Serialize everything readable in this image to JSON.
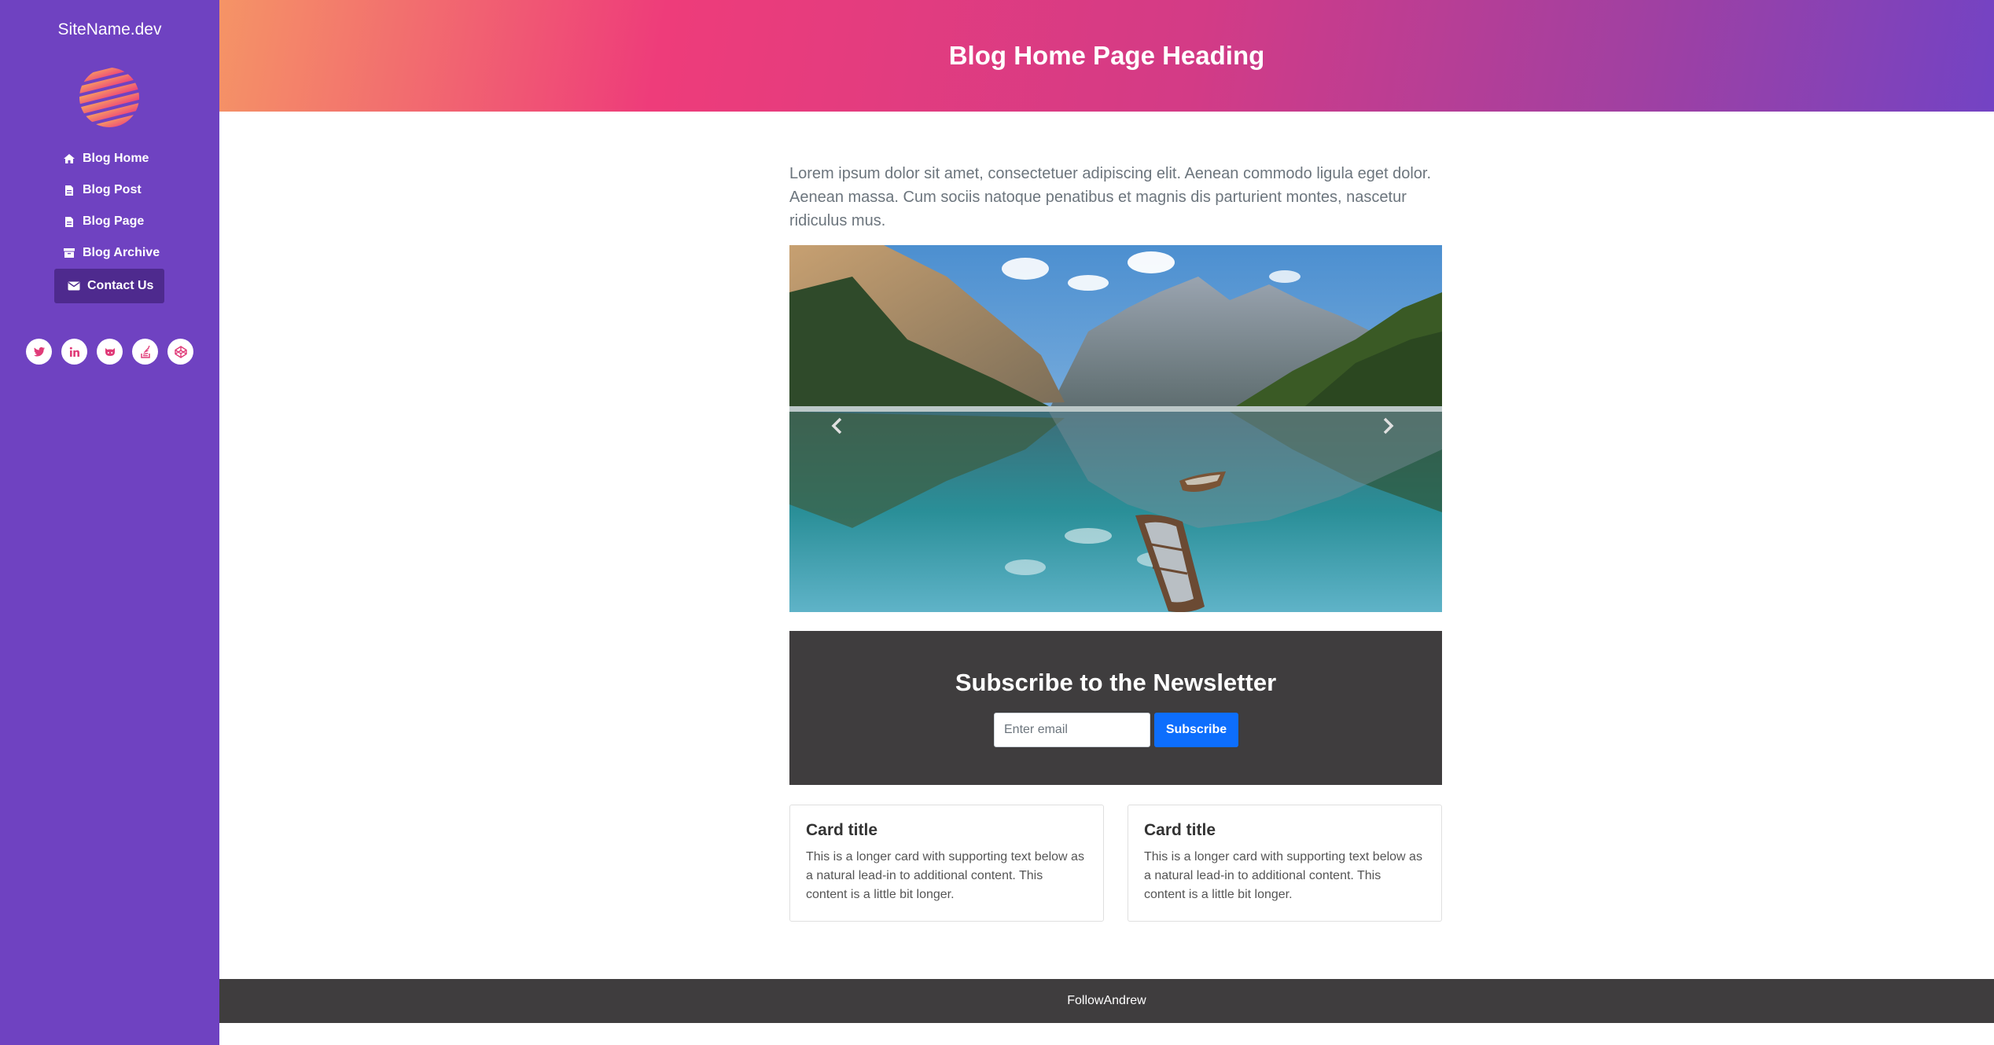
{
  "sidebar": {
    "site_name": "SiteName.dev",
    "logo_icon": "striped-globe-logo",
    "nav": [
      {
        "label": "Blog Home",
        "icon": "home-icon"
      },
      {
        "label": "Blog Post",
        "icon": "file-icon"
      },
      {
        "label": "Blog Page",
        "icon": "file-icon"
      },
      {
        "label": "Blog Archive",
        "icon": "archive-icon"
      },
      {
        "label": "Contact Us",
        "icon": "envelope-icon",
        "active": true
      }
    ],
    "social": [
      "twitter-icon",
      "linkedin-icon",
      "github-icon",
      "stackoverflow-icon",
      "codepen-icon"
    ]
  },
  "header": {
    "title": "Blog Home Page Heading"
  },
  "main": {
    "intro": "Lorem ipsum dolor sit amet, consectetuer adipiscing elit. Aenean commodo ligula eget dolor. Aenean massa. Cum sociis natoque penatibus et magnis dis parturient montes, nascetur ridiculus mus.",
    "carousel": {
      "image": "mountain-lake-with-boats",
      "prev_icon": "chevron-left-icon",
      "next_icon": "chevron-right-icon"
    },
    "newsletter": {
      "title": "Subscribe to the Newsletter",
      "email_placeholder": "Enter email",
      "email_value": "",
      "button": "Subscribe"
    },
    "cards": [
      {
        "title": "Card title",
        "text": "This is a longer card with supporting text below as a natural lead-in to additional content. This content is a little bit longer."
      },
      {
        "title": "Card title",
        "text": "This is a longer card with supporting text below as a natural lead-in to additional content. This content is a little bit longer."
      }
    ]
  },
  "footer": {
    "text": "FollowAndrew"
  },
  "colors": {
    "sidebar_bg": "#6f42c1",
    "active_nav_bg": "#4e2a8e",
    "accent_pink": "#ee3c7a",
    "newsletter_bg": "#3f3d3e",
    "button_blue": "#0d6efd"
  }
}
